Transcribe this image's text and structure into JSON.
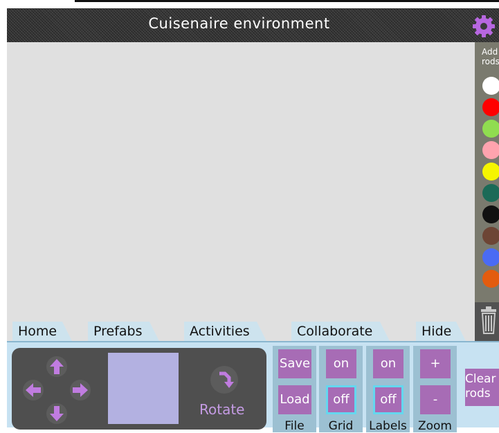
{
  "header": {
    "title": "Cuisenaire environment",
    "settings_icon": "gear-icon"
  },
  "colors": {
    "accent": "#a76cb5",
    "arrow": "#c07ce0",
    "toolbar_bg": "#c7e2f2",
    "preview": "#b3b1e1"
  },
  "palette": {
    "label": "Add rods",
    "swatches": [
      {
        "name": "white",
        "color": "#ffffff"
      },
      {
        "name": "red",
        "color": "#ff0000"
      },
      {
        "name": "light-green",
        "color": "#90dd50"
      },
      {
        "name": "pink",
        "color": "#ffa3ae"
      },
      {
        "name": "yellow",
        "color": "#f5f500"
      },
      {
        "name": "dark-green",
        "color": "#1b6a57"
      },
      {
        "name": "black",
        "color": "#111111"
      },
      {
        "name": "brown",
        "color": "#6d4535"
      },
      {
        "name": "blue",
        "color": "#4a6bf4"
      },
      {
        "name": "orange",
        "color": "#e35c0f"
      }
    ],
    "trash_icon": "trash-icon"
  },
  "tabs": [
    {
      "label": "Home"
    },
    {
      "label": "Prefabs"
    },
    {
      "label": "Activities"
    },
    {
      "label": "Collaborate"
    },
    {
      "label": "Hide"
    }
  ],
  "toolbar": {
    "rotate_label": "Rotate",
    "file": {
      "save": "Save",
      "load": "Load",
      "label": "File"
    },
    "grid": {
      "on": "on",
      "off": "off",
      "label": "Grid",
      "selected": "off"
    },
    "labels": {
      "on": "on",
      "off": "off",
      "label": "Labels",
      "selected": "off"
    },
    "zoom": {
      "plus": "+",
      "minus": "-",
      "label": "Zoom"
    },
    "clear": "Clear rods"
  }
}
